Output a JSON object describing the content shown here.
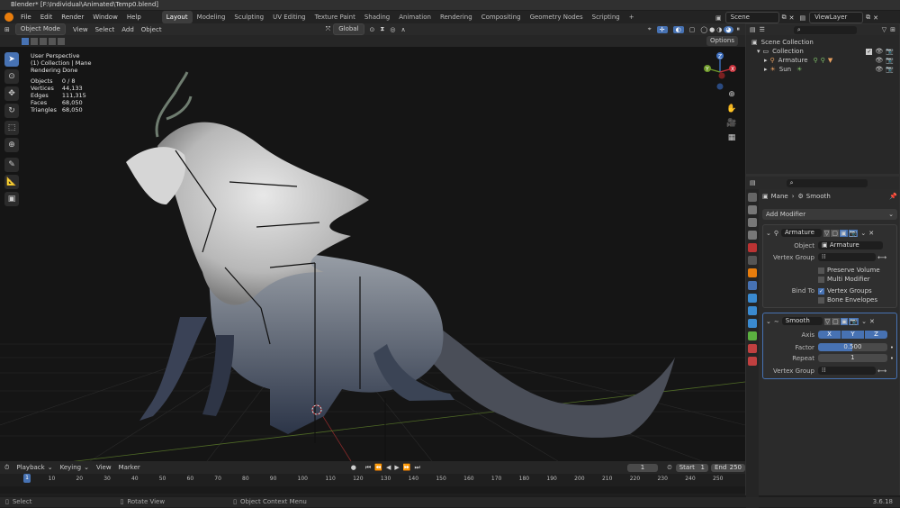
{
  "window_title": "Blender* [F:\\Individual\\Animated\\Temp0.blend]",
  "menu": [
    "File",
    "Edit",
    "Render",
    "Window",
    "Help"
  ],
  "workspaces": [
    "Layout",
    "Modeling",
    "Sculpting",
    "UV Editing",
    "Texture Paint",
    "Shading",
    "Animation",
    "Rendering",
    "Compositing",
    "Geometry Nodes",
    "Scripting",
    "+"
  ],
  "active_workspace": "Layout",
  "scene": "Scene",
  "view_layer": "ViewLayer",
  "viewport_header": {
    "mode": "Object Mode",
    "menus": [
      "View",
      "Select",
      "Add",
      "Object"
    ],
    "transform": "Global",
    "options": "Options"
  },
  "overlay_text": {
    "view": "User Perspective",
    "collection": "(1) Collection | Mane",
    "render": "Rendering Done",
    "stats": [
      {
        "label": "Objects",
        "value": "0 / 8"
      },
      {
        "label": "Vertices",
        "value": "44,133"
      },
      {
        "label": "Edges",
        "value": "111,315"
      },
      {
        "label": "Faces",
        "value": "68,050"
      },
      {
        "label": "Triangles",
        "value": "68,050"
      }
    ]
  },
  "gizmo": {
    "x": "X",
    "y": "Y",
    "z": "Z"
  },
  "outliner": {
    "root": "Scene Collection",
    "items": [
      {
        "name": "Collection",
        "icon": "collection-icon"
      },
      {
        "name": "Armature",
        "icon": "armature-icon"
      },
      {
        "name": "Sun",
        "icon": "sun-icon"
      }
    ]
  },
  "properties": {
    "breadcrumb_obj": "Mane",
    "breadcrumb_mod": "Smooth",
    "add_modifier": "Add Modifier",
    "armature_mod": {
      "name": "Armature",
      "object_label": "Object",
      "object_value": "Armature",
      "vgroup_label": "Vertex Group",
      "preserve_volume": "Preserve Volume",
      "multi_modifier": "Multi Modifier",
      "bind_to": "Bind To",
      "vertex_groups": "Vertex Groups",
      "bone_envelopes": "Bone Envelopes"
    },
    "smooth_mod": {
      "name": "Smooth",
      "axis_label": "Axis",
      "axes": [
        "X",
        "Y",
        "Z"
      ],
      "factor_label": "Factor",
      "factor_value": "0.500",
      "factor_fill": 0.5,
      "repeat_label": "Repeat",
      "repeat_value": "1",
      "vgroup_label": "Vertex Group"
    }
  },
  "timeline": {
    "menus": [
      "Playback",
      "Keying",
      "View",
      "Marker"
    ],
    "current_frame": "1",
    "start_label": "Start",
    "start": "1",
    "end_label": "End",
    "end": "250",
    "ticks": [
      "1",
      "10",
      "20",
      "30",
      "40",
      "50",
      "60",
      "70",
      "80",
      "90",
      "100",
      "110",
      "120",
      "130",
      "140",
      "150",
      "160",
      "170",
      "180",
      "190",
      "200",
      "210",
      "220",
      "230",
      "240",
      "250"
    ]
  },
  "statusbar": {
    "select": "Select",
    "rotate": "Rotate View",
    "context": "Object Context Menu",
    "version": "3.6.18"
  },
  "colors": {
    "accent": "#4772b3",
    "x_axis": "#c8303a",
    "y_axis": "#6f9a2a",
    "z_axis": "#3e6fbf"
  }
}
